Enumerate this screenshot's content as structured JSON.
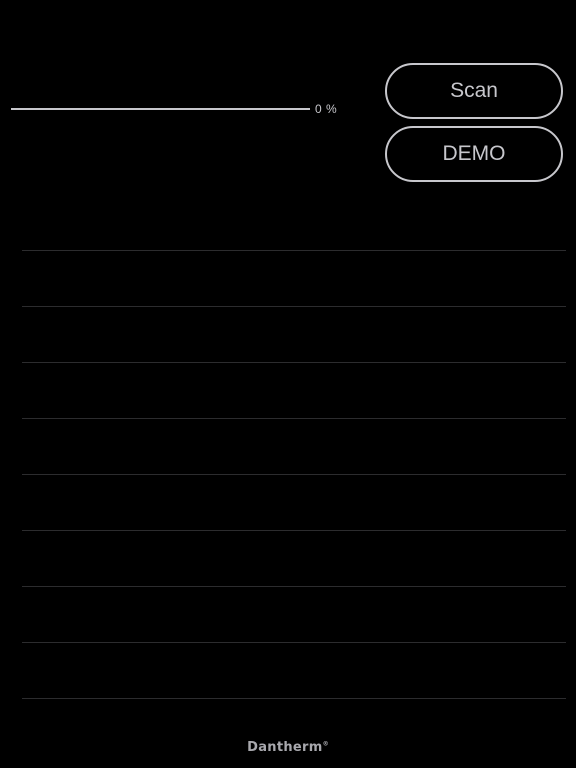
{
  "progress": {
    "value": 0,
    "label": "0 %"
  },
  "buttons": {
    "scan_label": "Scan",
    "demo_label": "DEMO"
  },
  "device_list": {
    "rows": 9
  },
  "footer": {
    "logo_text": "Dantherm",
    "logo_mark": "®"
  },
  "colors": {
    "background": "#000000",
    "foreground": "#c7c7cc",
    "separator": "#2c2c2e"
  }
}
